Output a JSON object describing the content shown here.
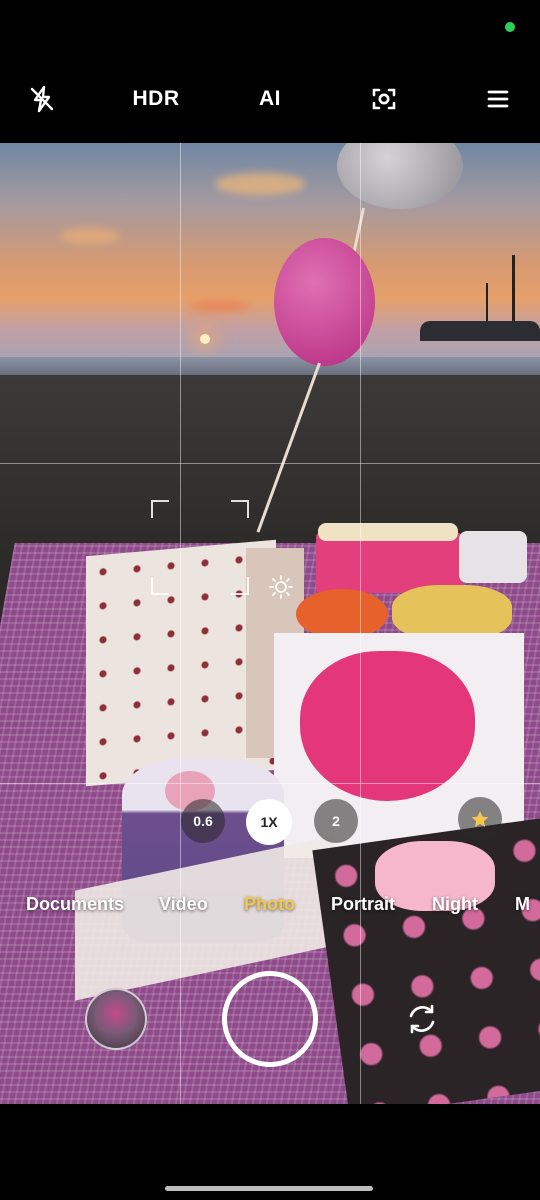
{
  "status": {
    "privacy_dot_color": "#2bd05a"
  },
  "toolbar": {
    "flash_icon": "flash-off-icon",
    "hdr_label": "HDR",
    "ai_label": "AI",
    "scan_icon": "scan-icon",
    "menu_icon": "menu-icon"
  },
  "viewfinder": {
    "exposure_icon": "sun-icon"
  },
  "zoom": {
    "options": [
      "0.6",
      "1X",
      "2"
    ],
    "selected": "1X",
    "effect_icon": "sparkle-star-icon"
  },
  "modes": {
    "items": [
      "Documents",
      "Video",
      "Photo",
      "Portrait",
      "Night",
      "M"
    ],
    "selected": "Photo"
  },
  "controls": {
    "gallery_icon": "gallery-thumbnail",
    "shutter_icon": "shutter-button",
    "switch_icon": "switch-camera-icon"
  },
  "colors": {
    "accent": "#f5c74c",
    "background": "#000000"
  }
}
